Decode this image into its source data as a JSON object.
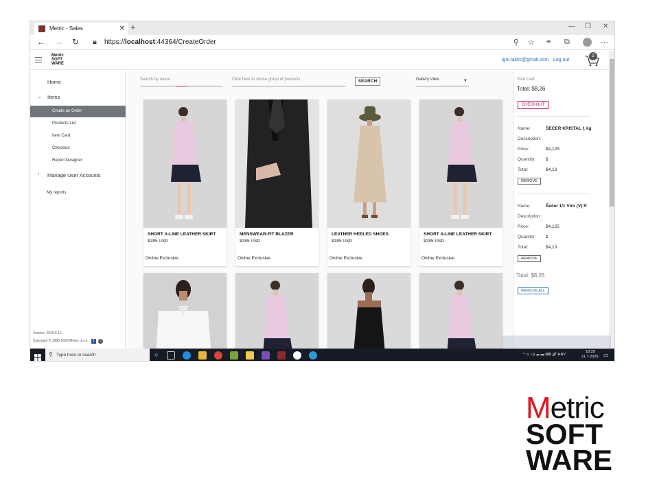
{
  "browser": {
    "tab_title": "Metric - Sales",
    "url_prefix": "https://",
    "url_host": "localhost",
    "url_rest": ":44364/CreateOrder"
  },
  "header": {
    "logo_lines": [
      "Metric",
      "SOFT",
      "WARE"
    ],
    "user_email": "igor.laktic@gmail.com",
    "logout_label": "Log out",
    "cart_count": "2"
  },
  "sidebar": {
    "items": [
      {
        "label": "Home"
      },
      {
        "label": "Items"
      },
      {
        "label": "Create an Order"
      },
      {
        "label": "Products List"
      },
      {
        "label": "Item Card"
      },
      {
        "label": "Checkout"
      },
      {
        "label": "Report Designer"
      },
      {
        "label": "Manage User Accounts"
      },
      {
        "label": "My reports"
      }
    ],
    "version": "Version: 2020.5.13",
    "copyright": "Copyright © 1990-2020 Metric d.o.o."
  },
  "toolbar": {
    "search_placeholder": "Search by name",
    "group_placeholder": "Click here to chose group of products",
    "search_label": "SEARCH",
    "view_value": "Gallery View"
  },
  "products": [
    {
      "name": "SHORT A-LINE LEATHER SKIRT",
      "price": "$285 USD",
      "tag": "Online Exclusive"
    },
    {
      "name": "MENSWEAR-FIT BLAZER",
      "price": "$285 USD",
      "tag": "Online Exclusive"
    },
    {
      "name": "LEATHER HEELED SHOES",
      "price": "$285 USD",
      "tag": "Online Exclusive"
    },
    {
      "name": "SHORT A-LINE LEATHER SKIRT",
      "price": "$285 USD",
      "tag": "Online Exclusive"
    }
  ],
  "cart": {
    "your_cart": "Your Cart:",
    "total_top": "Total: $8,26",
    "checkout_label": "CHECKOUT",
    "labels": {
      "name": "Name:",
      "description": "Description:",
      "price": "Price:",
      "quantity": "Quantity:",
      "total": "Total:"
    },
    "items": [
      {
        "name": "ŠEĆER KRISTAL 1 kg",
        "price": "$4,125",
        "quantity": "1",
        "total": "$4,13"
      },
      {
        "name": "Šećer 1/1 Viro (V) R",
        "price": "$4,125",
        "quantity": "1",
        "total": "$4,13"
      }
    ],
    "remove_label": "REMOVE",
    "total_bottom": "Total: $8,26",
    "remove_all_label": "REMOVE ALL"
  },
  "taskbar": {
    "search_placeholder": "Type here to search",
    "lang": "HRV",
    "time": "18:29",
    "date": "21.7.2020."
  },
  "brand": {
    "accent": "#e0141e",
    "active_nav": "#6f757a",
    "link": "#2a6ebb"
  }
}
